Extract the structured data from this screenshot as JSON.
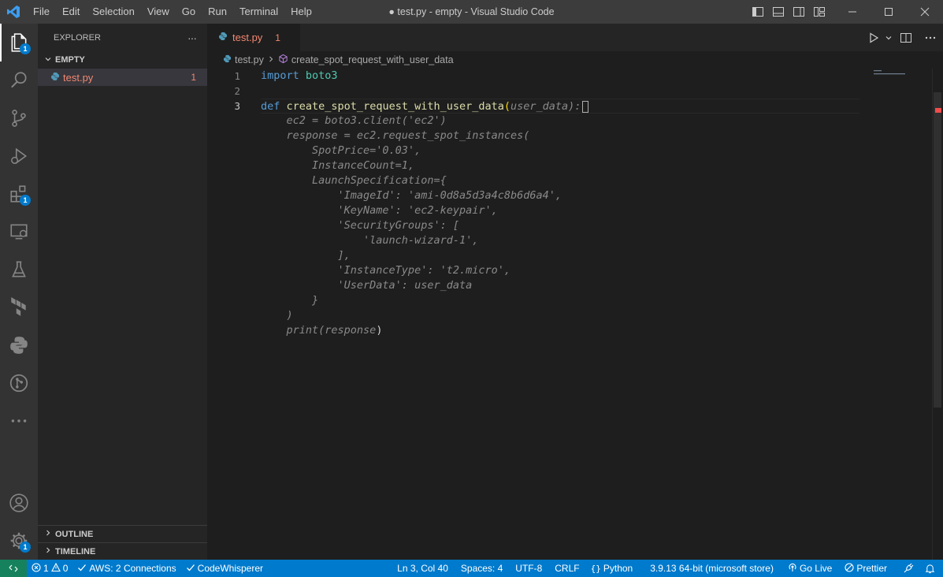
{
  "window": {
    "title": "● test.py - empty - Visual Studio Code",
    "menu": [
      "File",
      "Edit",
      "Selection",
      "View",
      "Go",
      "Run",
      "Terminal",
      "Help"
    ]
  },
  "activity_bar": {
    "explorer_badge": "1",
    "extensions_badge": "1",
    "settings_badge": "1"
  },
  "sidebar": {
    "header": "EXPLORER",
    "more": "···",
    "section": "EMPTY",
    "file": {
      "name": "test.py",
      "problems": "1"
    },
    "outline": "OUTLINE",
    "timeline": "TIMELINE"
  },
  "editor": {
    "tab": {
      "name": "test.py",
      "problems": "1"
    },
    "breadcrumb": {
      "file": "test.py",
      "symbol": "create_spot_request_with_user_data"
    },
    "line_numbers": [
      "1",
      "2",
      "3"
    ],
    "code": {
      "l1_kw": "import",
      "l1_mod": "boto3",
      "l3_kw": "def",
      "l3_fn": "create_spot_request_with_user_data",
      "l3_open": "(",
      "l3_ghost": "user_data):",
      "suggestion": [
        "    ec2 = boto3.client('ec2')",
        "    response = ec2.request_spot_instances(",
        "        SpotPrice='0.03',",
        "        InstanceCount=1,",
        "        LaunchSpecification={",
        "            'ImageId': 'ami-0d8a5d3a4c8b6d6a4',",
        "            'KeyName': 'ec2-keypair',",
        "            'SecurityGroups': [",
        "                'launch-wizard-1',",
        "            ],",
        "            'InstanceType': 't2.micro',",
        "            'UserData': user_data",
        "        }",
        "    )",
        "    print(response"
      ],
      "last_close": ")"
    }
  },
  "statusbar": {
    "errors": "1",
    "warnings": "0",
    "aws": "AWS: 2 Connections",
    "codewhisperer": "CodeWhisperer",
    "position": "Ln 3, Col 40",
    "spaces": "Spaces: 4",
    "encoding": "UTF-8",
    "eol": "CRLF",
    "language": "Python",
    "interpreter": "3.9.13 64-bit (microsoft store)",
    "golive": "Go Live",
    "prettier": "Prettier"
  },
  "colors": {
    "accent": "#007acc",
    "remote": "#16825d",
    "error": "#f48771"
  }
}
